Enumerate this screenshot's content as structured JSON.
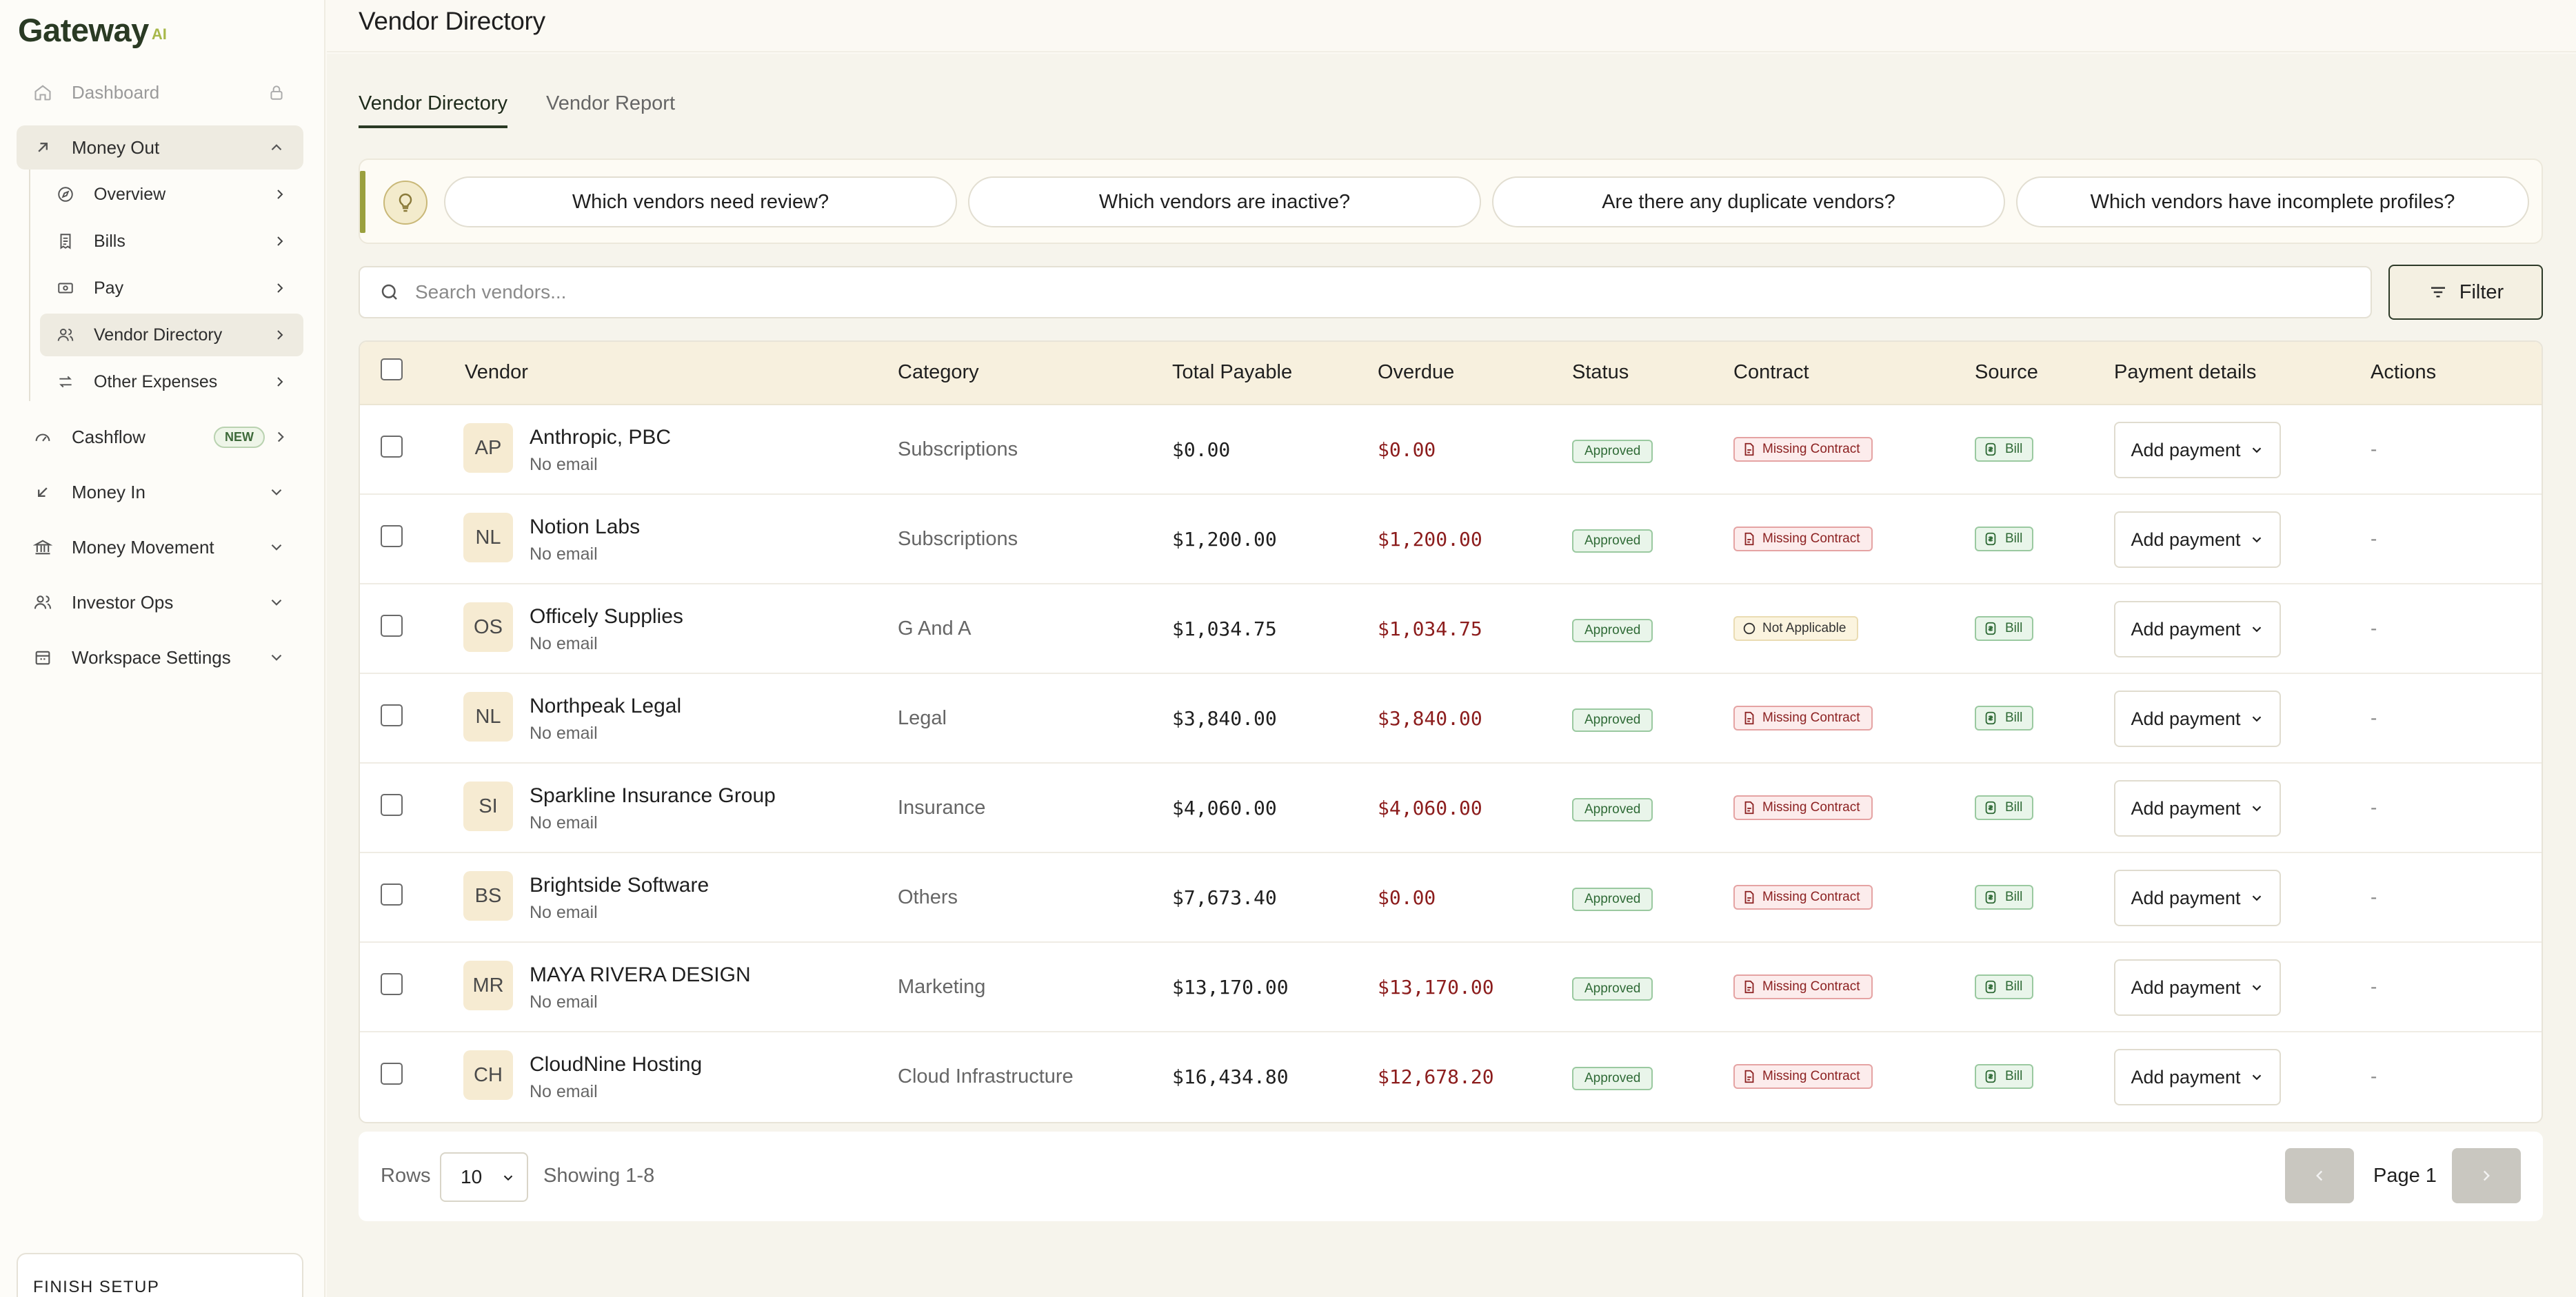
{
  "brand": {
    "name": "Gateway",
    "suffix": "AI"
  },
  "page_title": "Vendor Directory",
  "sidebar": {
    "items": [
      {
        "label": "Dashboard",
        "icon": "home-icon",
        "trail": "lock-icon",
        "muted": true
      },
      {
        "label": "Money Out",
        "icon": "arrow-up-right-icon",
        "trail": "chevron-up-icon",
        "expanded": true
      },
      {
        "label": "Cashflow",
        "icon": "gauge-icon",
        "trail": "chevron-right-icon",
        "badge": "NEW"
      },
      {
        "label": "Money In",
        "icon": "arrow-down-left-icon",
        "trail": "chevron-down-icon"
      },
      {
        "label": "Money Movement",
        "icon": "bank-icon",
        "trail": "chevron-down-icon"
      },
      {
        "label": "Investor Ops",
        "icon": "users-icon",
        "trail": "chevron-down-icon"
      },
      {
        "label": "Workspace Settings",
        "icon": "building-icon",
        "trail": "chevron-down-icon"
      }
    ],
    "sub_items": [
      {
        "label": "Overview",
        "icon": "compass-icon"
      },
      {
        "label": "Bills",
        "icon": "receipt-icon"
      },
      {
        "label": "Pay",
        "icon": "cash-icon"
      },
      {
        "label": "Vendor Directory",
        "icon": "users-icon",
        "active": true
      },
      {
        "label": "Other Expenses",
        "icon": "swap-icon"
      }
    ],
    "finish_setup": "FINISH SETUP"
  },
  "tabs": [
    {
      "label": "Vendor Directory",
      "active": true
    },
    {
      "label": "Vendor Report",
      "active": false
    }
  ],
  "suggestions": [
    "Which vendors need review?",
    "Which vendors are inactive?",
    "Are there any duplicate vendors?",
    "Which vendors have incomplete profiles?"
  ],
  "search": {
    "placeholder": "Search vendors..."
  },
  "filter_label": "Filter",
  "table": {
    "columns": [
      "Vendor",
      "Category",
      "Total Payable",
      "Overdue",
      "Status",
      "Contract",
      "Source",
      "Payment details",
      "Actions"
    ],
    "rows": [
      {
        "initials": "AP",
        "name": "Anthropic, PBC",
        "email": "No email",
        "category": "Subscriptions",
        "total": "$0.00",
        "overdue": "$0.00",
        "status": "Approved",
        "contract": "Missing Contract",
        "contract_type": "missing",
        "source": "Bill",
        "payment": "Add payment",
        "action": "-"
      },
      {
        "initials": "NL",
        "name": "Notion Labs",
        "email": "No email",
        "category": "Subscriptions",
        "total": "$1,200.00",
        "overdue": "$1,200.00",
        "status": "Approved",
        "contract": "Missing Contract",
        "contract_type": "missing",
        "source": "Bill",
        "payment": "Add payment",
        "action": "-"
      },
      {
        "initials": "OS",
        "name": "Officely Supplies",
        "email": "No email",
        "category": "G And A",
        "total": "$1,034.75",
        "overdue": "$1,034.75",
        "status": "Approved",
        "contract": "Not Applicable",
        "contract_type": "na",
        "source": "Bill",
        "payment": "Add payment",
        "action": "-"
      },
      {
        "initials": "NL",
        "name": "Northpeak Legal",
        "email": "No email",
        "category": "Legal",
        "total": "$3,840.00",
        "overdue": "$3,840.00",
        "status": "Approved",
        "contract": "Missing Contract",
        "contract_type": "missing",
        "source": "Bill",
        "payment": "Add payment",
        "action": "-"
      },
      {
        "initials": "SI",
        "name": "Sparkline Insurance Group",
        "email": "No email",
        "category": "Insurance",
        "total": "$4,060.00",
        "overdue": "$4,060.00",
        "status": "Approved",
        "contract": "Missing Contract",
        "contract_type": "missing",
        "source": "Bill",
        "payment": "Add payment",
        "action": "-"
      },
      {
        "initials": "BS",
        "name": "Brightside Software",
        "email": "No email",
        "category": "Others",
        "total": "$7,673.40",
        "overdue": "$0.00",
        "status": "Approved",
        "contract": "Missing Contract",
        "contract_type": "missing",
        "source": "Bill",
        "payment": "Add payment",
        "action": "-"
      },
      {
        "initials": "MR",
        "name": "MAYA RIVERA DESIGN",
        "email": "No email",
        "category": "Marketing",
        "total": "$13,170.00",
        "overdue": "$13,170.00",
        "status": "Approved",
        "contract": "Missing Contract",
        "contract_type": "missing",
        "source": "Bill",
        "payment": "Add payment",
        "action": "-"
      },
      {
        "initials": "CH",
        "name": "CloudNine Hosting",
        "email": "No email",
        "category": "Cloud Infrastructure",
        "total": "$16,434.80",
        "overdue": "$12,678.20",
        "status": "Approved",
        "contract": "Missing Contract",
        "contract_type": "missing",
        "source": "Bill",
        "payment": "Add payment",
        "action": "-"
      }
    ]
  },
  "pagination": {
    "rows_label": "Rows",
    "rows_value": "10",
    "showing": "Showing 1-8",
    "page_label": "Page 1"
  },
  "colors": {
    "brand": "#2a3a24",
    "accent": "#9aa03e",
    "overdue": "#8c1d1d",
    "approved": "#2f6a36"
  }
}
